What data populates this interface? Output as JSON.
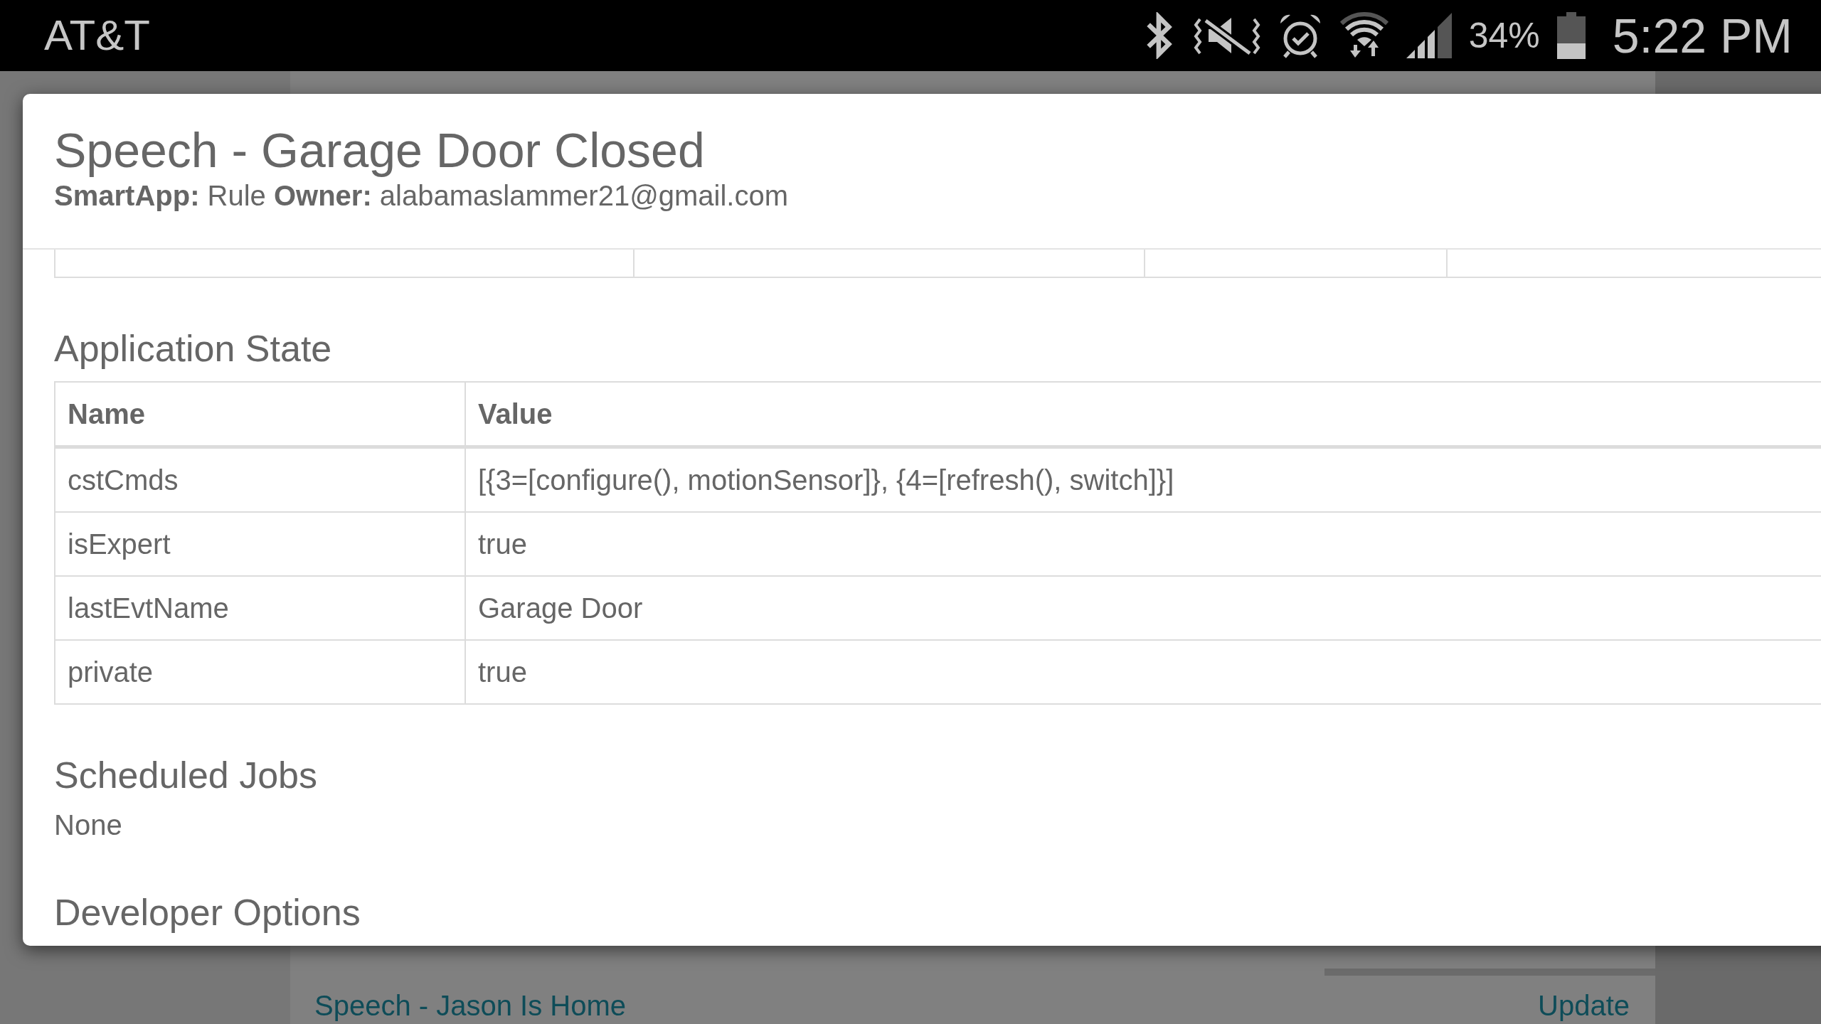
{
  "status_bar": {
    "carrier": "AT&T",
    "battery": "34%",
    "time": "5:22 PM"
  },
  "background_list": [
    {
      "title": "Speech - Jason Is Home",
      "action": "Update"
    }
  ],
  "dialog": {
    "title": "Speech - Garage Door Closed",
    "subtitle": "**SmartApp:** Rule **Owner:** alabamaslammer21@gmail.com",
    "sections": [
      {
        "kind": "table",
        "heading": "Application State",
        "columns": [
          "Name",
          "Value"
        ],
        "rows": [
          [
            "cstCmds",
            "[{3=[configure(), motionSensor]}, {4=[refresh(), switch]}]"
          ],
          [
            "isExpert",
            "true"
          ],
          [
            "lastEvtName",
            "Garage Door"
          ],
          [
            "private",
            "true"
          ]
        ]
      },
      {
        "kind": "text",
        "heading": "Scheduled Jobs",
        "text": "None"
      },
      {
        "kind": "heading",
        "heading": "Developer Options"
      }
    ]
  }
}
